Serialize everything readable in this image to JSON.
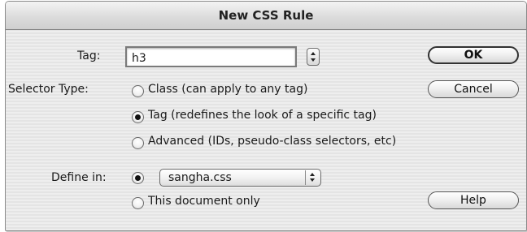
{
  "dialog": {
    "title": "New CSS Rule"
  },
  "tag": {
    "label": "Tag:",
    "value": "h3"
  },
  "selector_type": {
    "label": "Selector Type:",
    "options": [
      {
        "label": "Class (can apply to any tag)",
        "selected": false
      },
      {
        "label": "Tag (redefines the look of a specific tag)",
        "selected": true
      },
      {
        "label": "Advanced (IDs, pseudo-class selectors, etc)",
        "selected": false
      }
    ]
  },
  "define_in": {
    "label": "Define in:",
    "stylesheet_value": "sangha.css",
    "stylesheet_selected": true,
    "document_only_label": "This document only",
    "document_only_selected": false
  },
  "buttons": {
    "ok": "OK",
    "cancel": "Cancel",
    "help": "Help"
  },
  "colors": {
    "window_bg": "#eeeeee",
    "titlebar": "#dcdcdc",
    "text": "#1a1a1a"
  }
}
